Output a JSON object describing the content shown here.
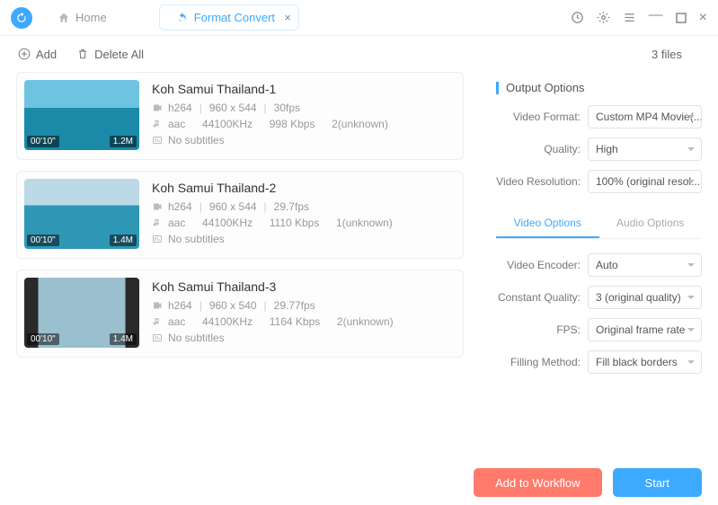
{
  "titlebar": {
    "home_label": "Home",
    "active_tab": "Format Convert"
  },
  "toolbar": {
    "add_label": "Add",
    "delete_all_label": "Delete All",
    "file_count": "3 files"
  },
  "files": [
    {
      "title": "Koh Samui Thailand-1",
      "duration": "00'10\"",
      "size": "1.2M",
      "vcodec": "h264",
      "dimensions": "960  x  544",
      "fps": "30fps",
      "acodec": "aac",
      "sample": "44100KHz",
      "bitrate": "998 Kbps",
      "channels": "2(unknown)",
      "subs": "No subtitles"
    },
    {
      "title": "Koh Samui Thailand-2",
      "duration": "00'10\"",
      "size": "1.4M",
      "vcodec": "h264",
      "dimensions": "960  x  544",
      "fps": "29.7fps",
      "acodec": "aac",
      "sample": "44100KHz",
      "bitrate": "1110 Kbps",
      "channels": "1(unknown)",
      "subs": "No subtitles"
    },
    {
      "title": "Koh Samui Thailand-3",
      "duration": "00'10\"",
      "size": "1.4M",
      "vcodec": "h264",
      "dimensions": "960  x  540",
      "fps": "29.77fps",
      "acodec": "aac",
      "sample": "44100KHz",
      "bitrate": "1164 Kbps",
      "channels": "2(unknown)",
      "subs": "No subtitles"
    }
  ],
  "output": {
    "section_title": "Output Options",
    "video_format_label": "Video Format:",
    "video_format_value": "Custom MP4 Movie(...",
    "quality_label": "Quality:",
    "quality_value": "High",
    "resolution_label": "Video Resolution:",
    "resolution_value": "100% (original resol...",
    "tabs": {
      "video": "Video Options",
      "audio": "Audio Options"
    },
    "video_encoder_label": "Video Encoder:",
    "video_encoder_value": "Auto",
    "constant_quality_label": "Constant Quality:",
    "constant_quality_value": "3 (original quality)",
    "fps_label": "FPS:",
    "fps_value": "Original frame rate",
    "filling_label": "Filling Method:",
    "filling_value": "Fill black borders"
  },
  "footer": {
    "workflow": "Add to Workflow",
    "start": "Start"
  }
}
